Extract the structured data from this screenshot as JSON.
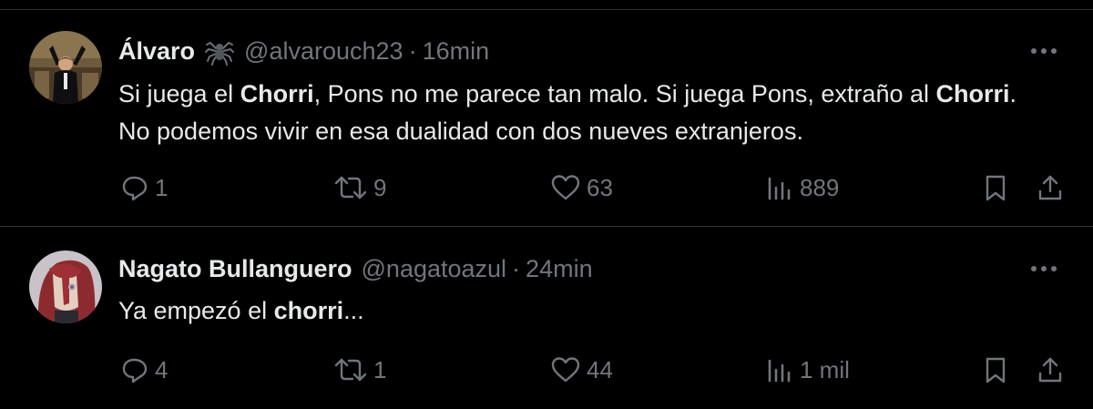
{
  "tweets": [
    {
      "display_name": "Álvaro",
      "handle": "@alvarouch23",
      "separator": "·",
      "time": "16min",
      "badge_icon": "spider-emoji",
      "text": {
        "p1": "Si juega el ",
        "b1": "Chorri",
        "p2": ", Pons no me parece tan malo. Si juega Pons, extraño al ",
        "b2": "Chorri",
        "p3": ". No podemos vivir en esa dualidad con dos nueves extranjeros."
      },
      "replies": "1",
      "retweets": "9",
      "likes": "63",
      "views": "889"
    },
    {
      "display_name": "Nagato Bullanguero",
      "handle": "@nagatoazul",
      "separator": "·",
      "time": "24min",
      "text": {
        "p1": "Ya empezó el ",
        "b1": "chorri",
        "p2": "..."
      },
      "replies": "4",
      "retweets": "1",
      "likes": "44",
      "views": "1 mil"
    }
  ],
  "icons": {
    "more": "more-dots-icon",
    "reply": "reply-icon",
    "retweet": "retweet-icon",
    "like": "heart-icon",
    "views": "views-bar-icon",
    "bookmark": "bookmark-icon",
    "share": "share-icon"
  },
  "colors": {
    "background": "#000000",
    "text": "#e7e9ea",
    "muted": "#71767b",
    "divider": "#2f3336"
  }
}
